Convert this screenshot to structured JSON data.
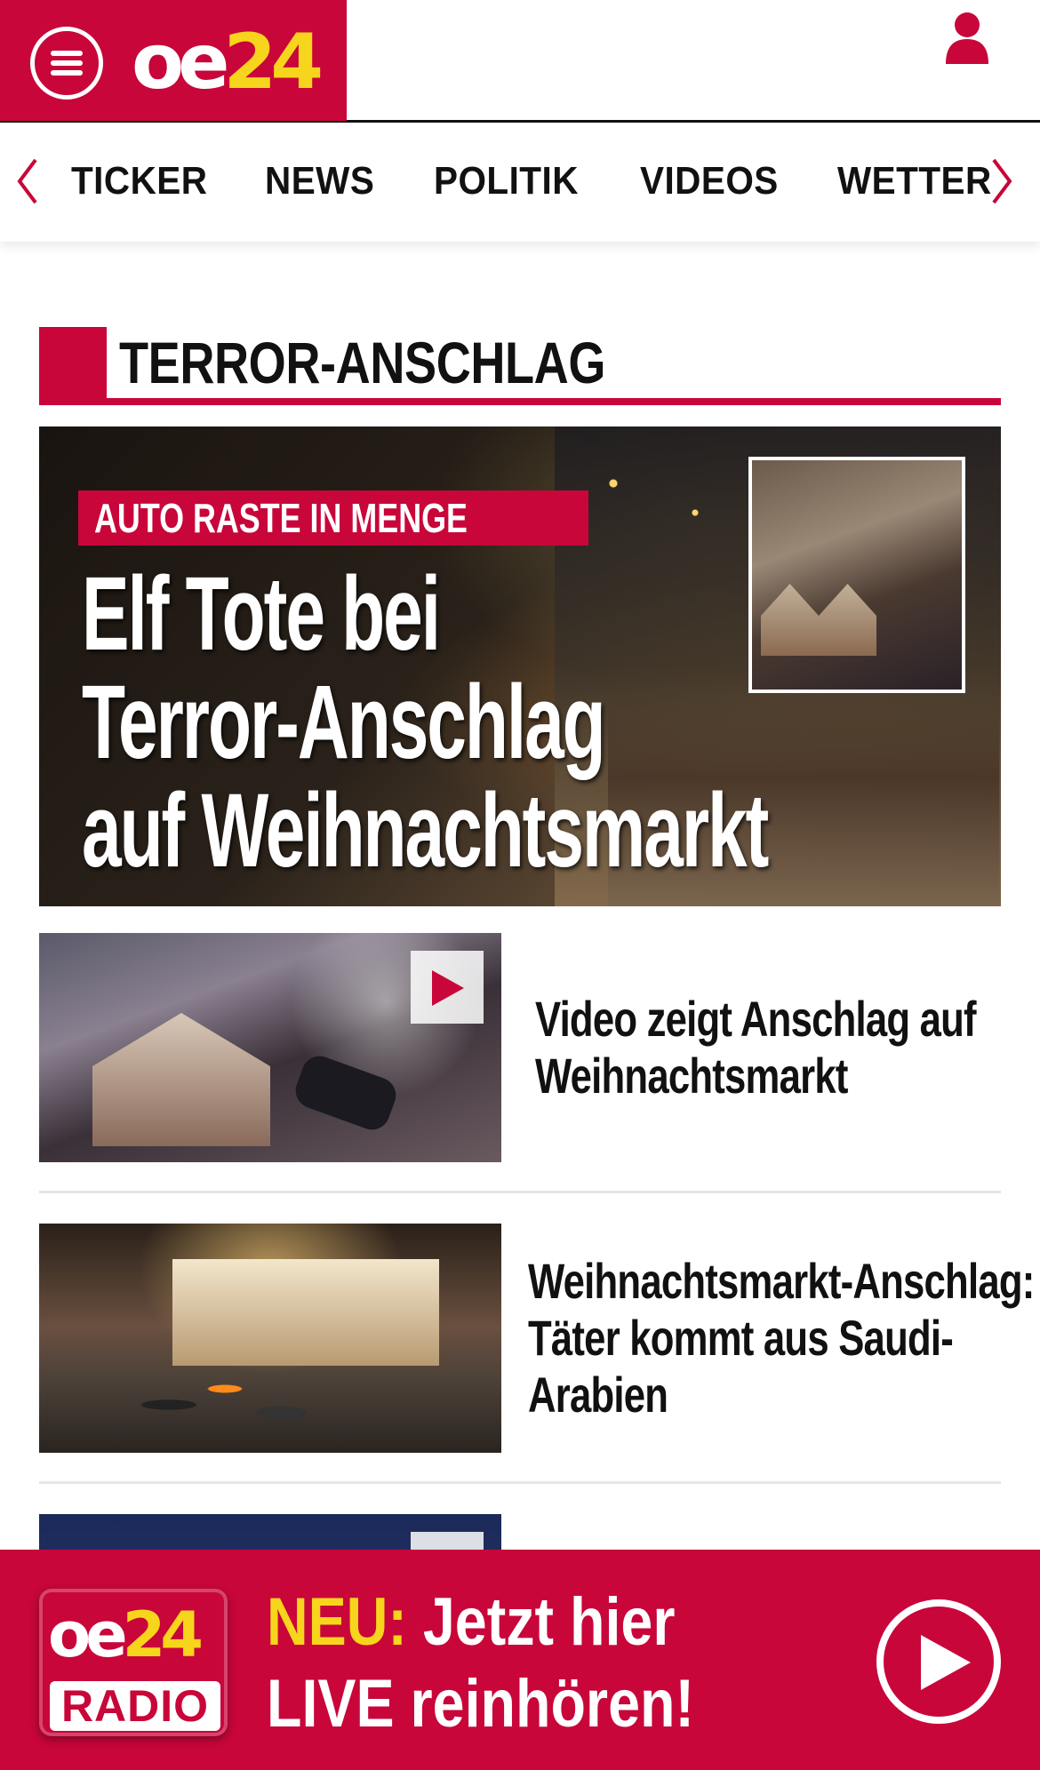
{
  "header": {
    "logo_main": "oe",
    "logo_num": "24",
    "menu_icon": "hamburger-menu-icon",
    "user_icon": "user-icon",
    "brand_color": "#c8063a",
    "accent_color": "#f7d51d"
  },
  "nav": {
    "items": [
      {
        "label": "TICKER"
      },
      {
        "label": "NEWS"
      },
      {
        "label": "POLITIK"
      },
      {
        "label": "VIDEOS"
      },
      {
        "label": "WETTER"
      }
    ],
    "prev_icon": "chevron-left-icon",
    "next_icon": "chevron-right-icon"
  },
  "section": {
    "title": "TERROR-ANSCHLAG"
  },
  "hero": {
    "tag": "AUTO RASTE IN MENGE",
    "headline_lines": [
      "Elf Tote bei",
      "Terror-Anschlag",
      "auf Weihnachtsmarkt"
    ]
  },
  "teasers": [
    {
      "title": "Video zeigt Anschlag auf Weihnachtsmarkt",
      "has_play": true
    },
    {
      "title": "Weihnachtsmarkt-Anschlag: Täter kommt aus Saudi-Arabien",
      "has_play": false
    }
  ],
  "radio": {
    "logo_main": "oe",
    "logo_num": "24",
    "logo_label": "RADIO",
    "line1_prefix": "NEU:",
    "line1_rest": " Jetzt hier",
    "line2": "LIVE reinhören!",
    "play_icon": "play-circle-icon"
  }
}
